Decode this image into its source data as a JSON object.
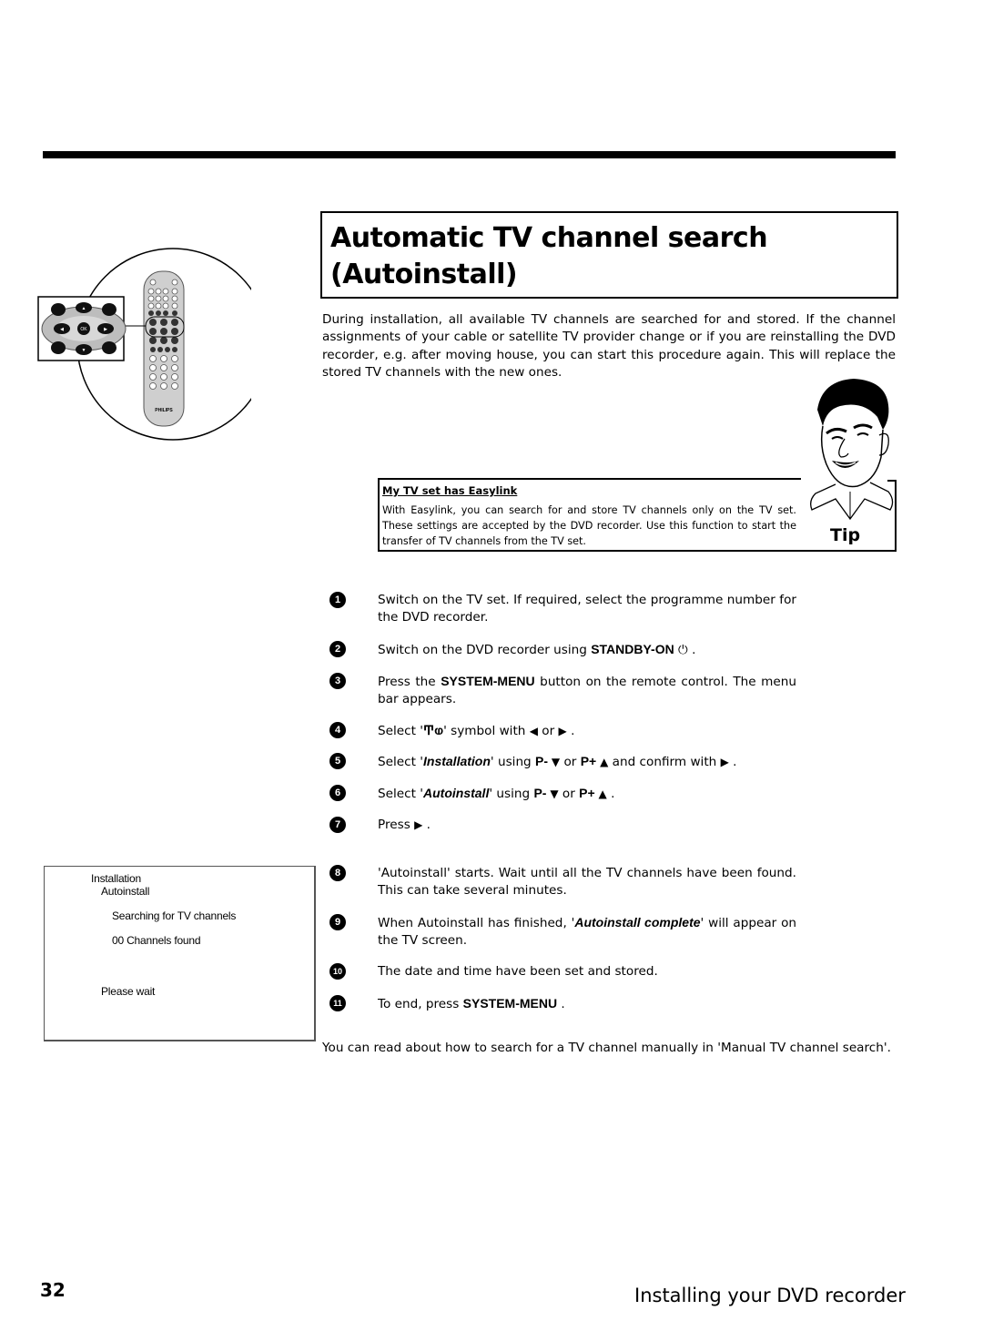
{
  "page": {
    "title": "Automatic TV channel search (Autoinstall)",
    "intro": "During installation, all available TV channels are searched for and stored. If the channel assignments of your cable or satellite TV provider change or if you are reinstalling the DVD recorder, e.g. after moving house, you can start this procedure again. This will replace the stored TV channels with the new ones.",
    "page_number": "32",
    "section": "Installing your DVD recorder",
    "footer_note": "You can read about how to search for a TV channel manually in 'Manual TV channel search'."
  },
  "remote": {
    "icon": "remote-control-icon",
    "ok_label": "OK",
    "brand": "PHILIPS"
  },
  "tip": {
    "heading": "My TV set has Easylink",
    "text": "With Easylink, you can search for and store TV channels only on the TV set. These settings are accepted by the DVD recorder. Use this function to start the transfer of TV channels from the TV set.",
    "label": "Tip",
    "icon": "cartoon-face-icon"
  },
  "steps": [
    {
      "num": "1",
      "parts": [
        {
          "t": "Switch on the TV set. If required, select the programme number for the DVD recorder."
        }
      ]
    },
    {
      "num": "2",
      "parts": [
        {
          "t": "Switch on the DVD recorder using "
        },
        {
          "k": "STANDBY-ON"
        },
        {
          "t": " ⏻ ."
        }
      ]
    },
    {
      "num": "3",
      "parts": [
        {
          "t": "Press the "
        },
        {
          "k": "SYSTEM-MENU"
        },
        {
          "t": " button on the remote control. The menu bar appears."
        }
      ]
    },
    {
      "num": "4",
      "parts": [
        {
          "t": "Select '"
        },
        {
          "sym": "Ͳⱷ"
        },
        {
          "t": "' symbol with "
        },
        {
          "tri": "◀"
        },
        {
          "t": " or "
        },
        {
          "tri": "▶"
        },
        {
          "t": " ."
        }
      ]
    },
    {
      "num": "5",
      "parts": [
        {
          "t": "Select '"
        },
        {
          "i": "Installation"
        },
        {
          "t": "' using "
        },
        {
          "k": "P- "
        },
        {
          "tri": "▼"
        },
        {
          "t": " or "
        },
        {
          "k": "P+ "
        },
        {
          "tri": "▲"
        },
        {
          "t": " and confirm with "
        },
        {
          "tri": "▶"
        },
        {
          "t": " ."
        }
      ]
    },
    {
      "num": "6",
      "parts": [
        {
          "t": "Select '"
        },
        {
          "i": "Autoinstall"
        },
        {
          "t": "' using "
        },
        {
          "k": "P- "
        },
        {
          "tri": "▼"
        },
        {
          "t": " or "
        },
        {
          "k": "P+ "
        },
        {
          "tri": "▲"
        },
        {
          "t": " ."
        }
      ]
    },
    {
      "num": "7",
      "parts": [
        {
          "t": "Press "
        },
        {
          "tri": "▶"
        },
        {
          "t": " ."
        }
      ]
    },
    {
      "num": "8",
      "parts": [
        {
          "t": "'Autoinstall' starts. Wait until all the TV channels have been found. This can take several minutes."
        }
      ]
    },
    {
      "num": "9",
      "parts": [
        {
          "t": "When Autoinstall has finished, '"
        },
        {
          "i": "Autoinstall complete"
        },
        {
          "t": "' will appear on the TV screen."
        }
      ]
    },
    {
      "num": "10",
      "parts": [
        {
          "t": "The date and time have been set and stored."
        }
      ]
    },
    {
      "num": "11",
      "parts": [
        {
          "t": "To end, press "
        },
        {
          "k": "SYSTEM-MENU"
        },
        {
          "t": " ."
        }
      ]
    }
  ],
  "osd": {
    "menu": "Installation",
    "submenu": "Autoinstall",
    "status": "Searching for TV channels",
    "count": "00 Channels found",
    "wait": "Please wait"
  }
}
